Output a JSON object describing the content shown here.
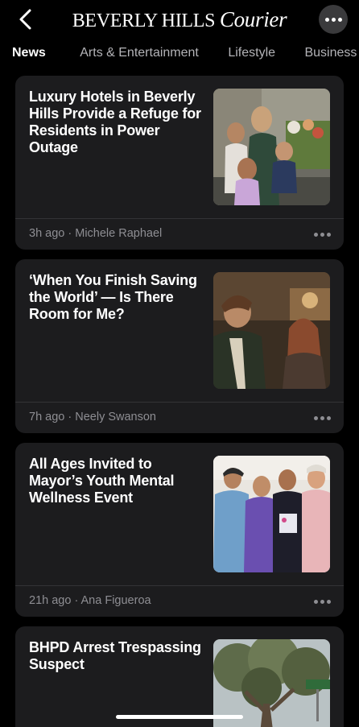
{
  "header": {
    "brand_part1": "BEVERLY HILLS ",
    "brand_part2": "Courier",
    "back_icon": "chevron-left-icon",
    "more_icon": "ellipsis-icon"
  },
  "tabs": [
    {
      "label": "News",
      "active": true
    },
    {
      "label": "Arts & Entertainment",
      "active": false
    },
    {
      "label": "Lifestyle",
      "active": false
    },
    {
      "label": "Business",
      "active": false
    }
  ],
  "articles": [
    {
      "headline": "Luxury Hotels in Beverly Hills Provide a Refuge for Residents in Power Outage",
      "time": "3h ago",
      "author": "Michele Raphael",
      "image": "family-photo"
    },
    {
      "headline": "‘When You Finish Saving the World’ — Is There Room for Me?",
      "time": "7h ago",
      "author": "Neely Swanson",
      "image": "film-still"
    },
    {
      "headline": "All Ages Invited to Mayor’s Youth Mental Wellness Event",
      "time": "21h ago",
      "author": "Ana Figueroa",
      "image": "group-photo"
    },
    {
      "headline": "BHPD Arrest Trespassing Suspect",
      "image": "street-tree-photo"
    }
  ],
  "colors": {
    "background": "#000000",
    "card": "#1c1c1e",
    "meta_text": "#8e8e93"
  }
}
